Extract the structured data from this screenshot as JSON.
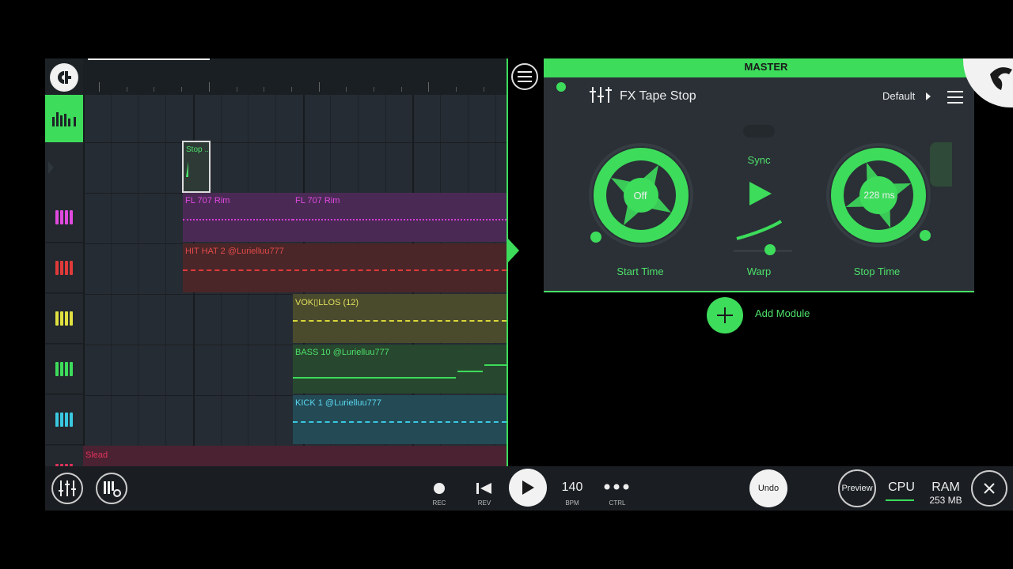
{
  "header": {
    "master_label": "MASTER"
  },
  "effect": {
    "name": "FX Tape Stop",
    "preset": "Default",
    "start_knob_value": "Off",
    "start_label": "Start Time",
    "sync_label": "Sync",
    "warp_label": "Warp",
    "stop_knob_value": "228 ms",
    "stop_label": "Stop Time",
    "add_module": "Add Module"
  },
  "clips": {
    "stop_clip": "Stop ...",
    "rim1": "FL 707 Rim",
    "rim2": "FL 707 Rim",
    "hihat": "HIT HAT 2 @Lurielluu777",
    "vox": "VOK▯LLOS (12)",
    "bass": "BASS 10 @Lurielluu777",
    "kick": "KICK 1 @Lurielluu777",
    "slead": "Slead"
  },
  "transport": {
    "rec": "REC",
    "rev": "REV",
    "bpm_value": "140",
    "bpm": "BPM",
    "ctrl": "CTRL",
    "undo": "Undo",
    "preview": "Preview",
    "cpu": "CPU",
    "ram": "RAM",
    "ram_value": "253 MB"
  },
  "colors": {
    "accent": "#3ddc5b",
    "rim": "#d63bd6",
    "hihat": "#e03a3a",
    "vox": "#d8d83a",
    "bass": "#3ddc5b",
    "kick": "#3ac8e0",
    "slead": "#e0335c"
  },
  "icons": [
    "mixer-icon",
    "piano-settings-icon",
    "record-icon",
    "rewind-icon",
    "play-icon",
    "more-icon",
    "close-icon",
    "menu-icon",
    "plus-icon",
    "fl-logo-icon"
  ]
}
